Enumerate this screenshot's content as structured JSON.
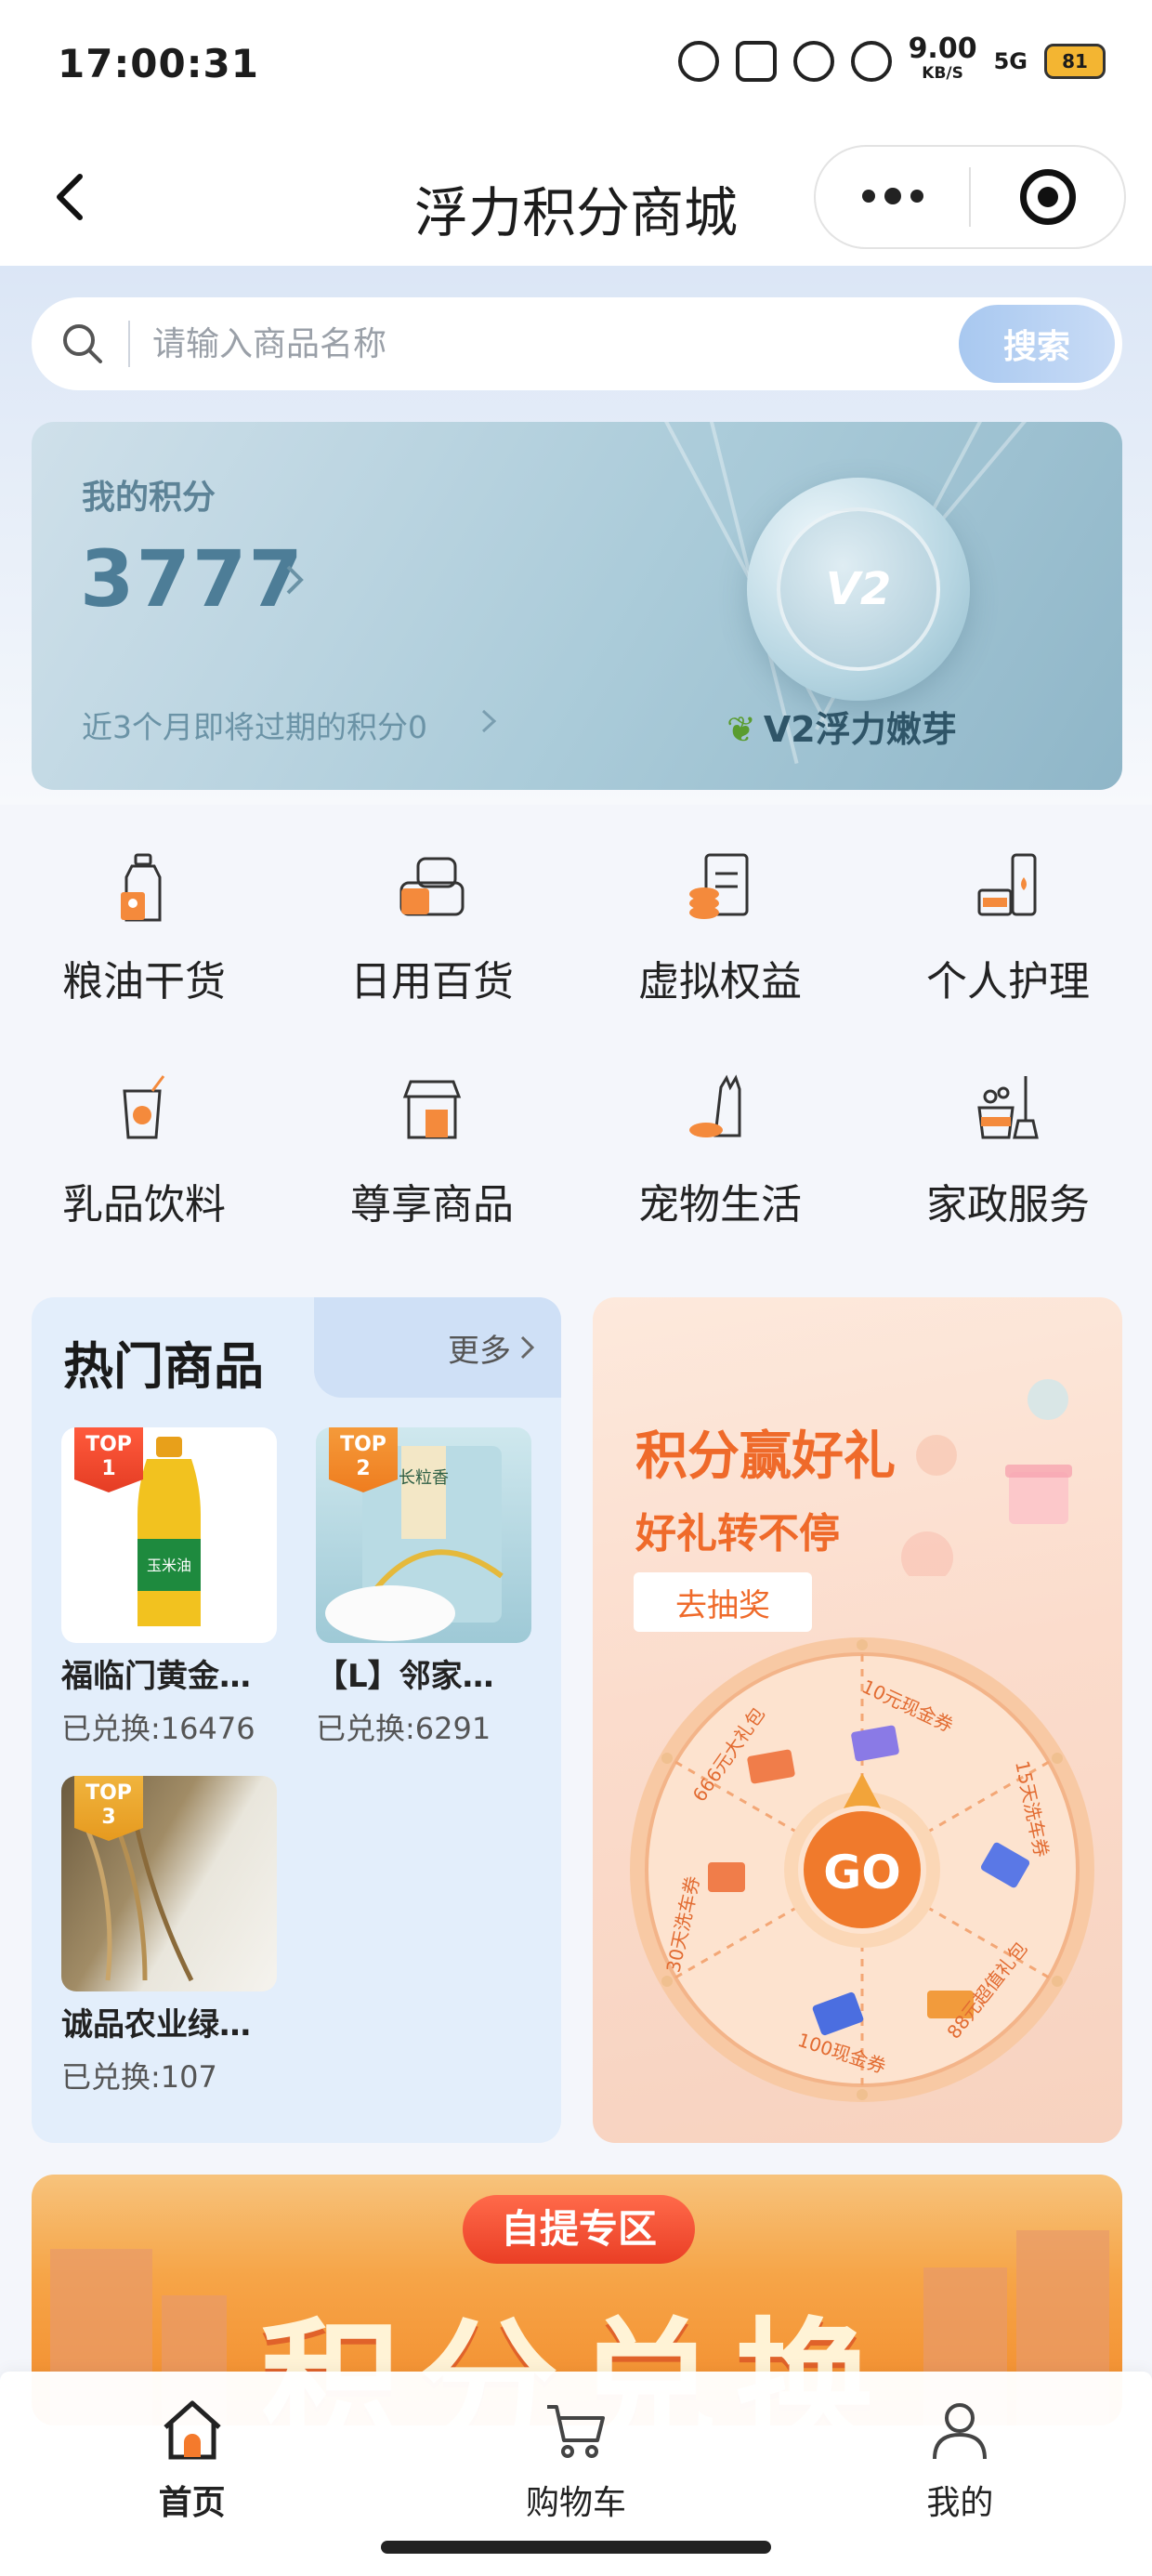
{
  "status_bar": {
    "time": "17:00:31",
    "network_speed": "9.00",
    "network_unit": "KB/S",
    "signal": "5G",
    "battery": "81"
  },
  "nav": {
    "title": "浮力积分商城"
  },
  "search": {
    "placeholder": "请输入商品名称",
    "button_label": "搜索"
  },
  "points_card": {
    "label": "我的积分",
    "value": "3777",
    "expire_text": "近3个月即将过期的积分0",
    "coin_text": "V2",
    "brand": "V2浮力嫩芽"
  },
  "categories": [
    {
      "label": "粮油干货",
      "icon": "grain-oil-icon"
    },
    {
      "label": "日用百货",
      "icon": "daily-goods-icon"
    },
    {
      "label": "虚拟权益",
      "icon": "virtual-rights-icon"
    },
    {
      "label": "个人护理",
      "icon": "personal-care-icon"
    },
    {
      "label": "乳品饮料",
      "icon": "dairy-drink-icon"
    },
    {
      "label": "尊享商品",
      "icon": "premium-goods-icon"
    },
    {
      "label": "宠物生活",
      "icon": "pet-life-icon"
    },
    {
      "label": "家政服务",
      "icon": "housekeeping-icon"
    }
  ],
  "hot_goods": {
    "title": "热门商品",
    "more_label": "更多",
    "items": [
      {
        "rank_label": "TOP",
        "rank": "1",
        "name": "福临门黄金…",
        "count": "已兑换:16476",
        "img_text": "玉米油"
      },
      {
        "rank_label": "TOP",
        "rank": "2",
        "name": "【L】邻家…",
        "count": "已兑换:6291",
        "img_text": "长粒香"
      },
      {
        "rank_label": "TOP",
        "rank": "3",
        "name": "诚品农业绿…",
        "count": "已兑换:107",
        "img_text": ""
      }
    ]
  },
  "lottery": {
    "title": "积分赢好礼",
    "subtitle": "好礼转不停",
    "button_label": "去抽奖",
    "go_label": "GO",
    "prizes": [
      "10元现金券",
      "15天洗车券",
      "88元超值礼包",
      "100现金券",
      "30天洗车券",
      "666元大礼包"
    ]
  },
  "banner": {
    "pill_label": "自提专区",
    "big_text": "积分兑换"
  },
  "tabbar": {
    "items": [
      {
        "label": "首页",
        "icon": "home-icon",
        "active": true
      },
      {
        "label": "购物车",
        "icon": "cart-icon",
        "active": false
      },
      {
        "label": "我的",
        "icon": "profile-icon",
        "active": false
      }
    ]
  },
  "colors": {
    "accent_orange": "#ef6a2a",
    "points_text": "#4d7d97",
    "hot_panel_bg": "#e3eefb"
  }
}
